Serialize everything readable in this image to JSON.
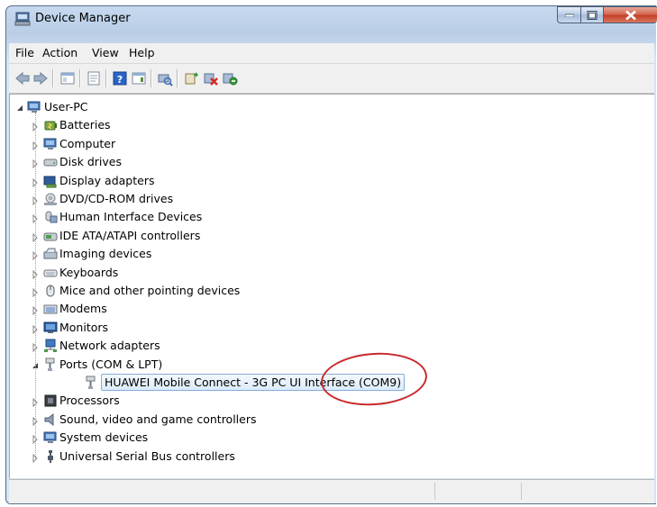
{
  "window": {
    "title": "Device Manager",
    "title_icon": "device-manager-icon",
    "controls": [
      "minimize",
      "maximize",
      "close"
    ]
  },
  "menu": [
    "File",
    "Action",
    "View",
    "Help"
  ],
  "toolbar": [
    "back-arrow-icon",
    "forward-arrow-icon",
    "show-hide-console-tree-icon",
    "properties-icon",
    "help-icon",
    "show-hide-action-pane-icon",
    "scan-hardware-icon",
    "update-driver-icon",
    "uninstall-icon",
    "disable-device-icon"
  ],
  "tree": {
    "root": "User-PC",
    "items": [
      {
        "label": "Batteries",
        "icon": "battery-icon",
        "expanded": false
      },
      {
        "label": "Computer",
        "icon": "computer-icon",
        "expanded": false
      },
      {
        "label": "Disk drives",
        "icon": "disk-drive-icon",
        "expanded": false
      },
      {
        "label": "Display adapters",
        "icon": "display-adapter-icon",
        "expanded": false
      },
      {
        "label": "DVD/CD-ROM drives",
        "icon": "dvd-drive-icon",
        "expanded": false
      },
      {
        "label": "Human Interface Devices",
        "icon": "hid-icon",
        "expanded": false
      },
      {
        "label": "IDE ATA/ATAPI controllers",
        "icon": "ide-controller-icon",
        "expanded": false
      },
      {
        "label": "Imaging devices",
        "icon": "imaging-device-icon",
        "expanded": false
      },
      {
        "label": "Keyboards",
        "icon": "keyboard-icon",
        "expanded": false
      },
      {
        "label": "Mice and other pointing devices",
        "icon": "mouse-icon",
        "expanded": false
      },
      {
        "label": "Modems",
        "icon": "modem-icon",
        "expanded": false
      },
      {
        "label": "Monitors",
        "icon": "monitor-icon",
        "expanded": false
      },
      {
        "label": "Network adapters",
        "icon": "network-adapter-icon",
        "expanded": false
      },
      {
        "label": "Ports (COM & LPT)",
        "icon": "port-icon",
        "expanded": true,
        "children": [
          {
            "label": "HUAWEI Mobile Connect - 3G PC UI Interface (COM9)",
            "icon": "port-icon",
            "selected": true
          }
        ]
      },
      {
        "label": "Processors",
        "icon": "processor-icon",
        "expanded": false
      },
      {
        "label": "Sound, video and game controllers",
        "icon": "sound-icon",
        "expanded": false
      },
      {
        "label": "System devices",
        "icon": "system-device-icon",
        "expanded": false
      },
      {
        "label": "Universal Serial Bus controllers",
        "icon": "usb-icon",
        "expanded": false
      }
    ]
  },
  "annotation": {
    "color": "#c8292c"
  },
  "colors": {
    "title_gradient_top": "#c6d9ef",
    "close_button": "#c33e25",
    "selection_border": "#84acdd"
  }
}
